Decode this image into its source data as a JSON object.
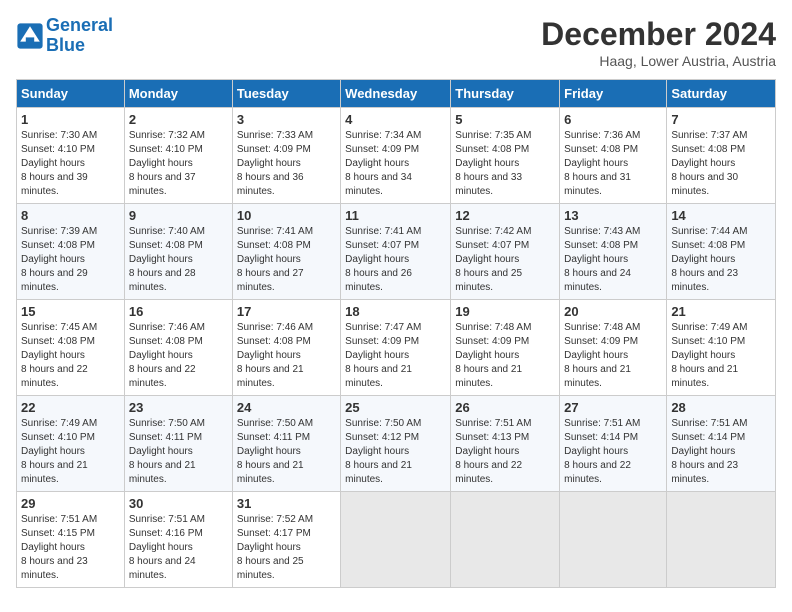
{
  "logo": {
    "line1": "General",
    "line2": "Blue"
  },
  "title": "December 2024",
  "location": "Haag, Lower Austria, Austria",
  "days_of_week": [
    "Sunday",
    "Monday",
    "Tuesday",
    "Wednesday",
    "Thursday",
    "Friday",
    "Saturday"
  ],
  "weeks": [
    [
      {
        "day": "1",
        "sunrise": "7:30 AM",
        "sunset": "4:10 PM",
        "daylight": "8 hours and 39 minutes."
      },
      {
        "day": "2",
        "sunrise": "7:32 AM",
        "sunset": "4:10 PM",
        "daylight": "8 hours and 37 minutes."
      },
      {
        "day": "3",
        "sunrise": "7:33 AM",
        "sunset": "4:09 PM",
        "daylight": "8 hours and 36 minutes."
      },
      {
        "day": "4",
        "sunrise": "7:34 AM",
        "sunset": "4:09 PM",
        "daylight": "8 hours and 34 minutes."
      },
      {
        "day": "5",
        "sunrise": "7:35 AM",
        "sunset": "4:08 PM",
        "daylight": "8 hours and 33 minutes."
      },
      {
        "day": "6",
        "sunrise": "7:36 AM",
        "sunset": "4:08 PM",
        "daylight": "8 hours and 31 minutes."
      },
      {
        "day": "7",
        "sunrise": "7:37 AM",
        "sunset": "4:08 PM",
        "daylight": "8 hours and 30 minutes."
      }
    ],
    [
      {
        "day": "8",
        "sunrise": "7:39 AM",
        "sunset": "4:08 PM",
        "daylight": "8 hours and 29 minutes."
      },
      {
        "day": "9",
        "sunrise": "7:40 AM",
        "sunset": "4:08 PM",
        "daylight": "8 hours and 28 minutes."
      },
      {
        "day": "10",
        "sunrise": "7:41 AM",
        "sunset": "4:08 PM",
        "daylight": "8 hours and 27 minutes."
      },
      {
        "day": "11",
        "sunrise": "7:41 AM",
        "sunset": "4:07 PM",
        "daylight": "8 hours and 26 minutes."
      },
      {
        "day": "12",
        "sunrise": "7:42 AM",
        "sunset": "4:07 PM",
        "daylight": "8 hours and 25 minutes."
      },
      {
        "day": "13",
        "sunrise": "7:43 AM",
        "sunset": "4:08 PM",
        "daylight": "8 hours and 24 minutes."
      },
      {
        "day": "14",
        "sunrise": "7:44 AM",
        "sunset": "4:08 PM",
        "daylight": "8 hours and 23 minutes."
      }
    ],
    [
      {
        "day": "15",
        "sunrise": "7:45 AM",
        "sunset": "4:08 PM",
        "daylight": "8 hours and 22 minutes."
      },
      {
        "day": "16",
        "sunrise": "7:46 AM",
        "sunset": "4:08 PM",
        "daylight": "8 hours and 22 minutes."
      },
      {
        "day": "17",
        "sunrise": "7:46 AM",
        "sunset": "4:08 PM",
        "daylight": "8 hours and 21 minutes."
      },
      {
        "day": "18",
        "sunrise": "7:47 AM",
        "sunset": "4:09 PM",
        "daylight": "8 hours and 21 minutes."
      },
      {
        "day": "19",
        "sunrise": "7:48 AM",
        "sunset": "4:09 PM",
        "daylight": "8 hours and 21 minutes."
      },
      {
        "day": "20",
        "sunrise": "7:48 AM",
        "sunset": "4:09 PM",
        "daylight": "8 hours and 21 minutes."
      },
      {
        "day": "21",
        "sunrise": "7:49 AM",
        "sunset": "4:10 PM",
        "daylight": "8 hours and 21 minutes."
      }
    ],
    [
      {
        "day": "22",
        "sunrise": "7:49 AM",
        "sunset": "4:10 PM",
        "daylight": "8 hours and 21 minutes."
      },
      {
        "day": "23",
        "sunrise": "7:50 AM",
        "sunset": "4:11 PM",
        "daylight": "8 hours and 21 minutes."
      },
      {
        "day": "24",
        "sunrise": "7:50 AM",
        "sunset": "4:11 PM",
        "daylight": "8 hours and 21 minutes."
      },
      {
        "day": "25",
        "sunrise": "7:50 AM",
        "sunset": "4:12 PM",
        "daylight": "8 hours and 21 minutes."
      },
      {
        "day": "26",
        "sunrise": "7:51 AM",
        "sunset": "4:13 PM",
        "daylight": "8 hours and 22 minutes."
      },
      {
        "day": "27",
        "sunrise": "7:51 AM",
        "sunset": "4:14 PM",
        "daylight": "8 hours and 22 minutes."
      },
      {
        "day": "28",
        "sunrise": "7:51 AM",
        "sunset": "4:14 PM",
        "daylight": "8 hours and 23 minutes."
      }
    ],
    [
      {
        "day": "29",
        "sunrise": "7:51 AM",
        "sunset": "4:15 PM",
        "daylight": "8 hours and 23 minutes."
      },
      {
        "day": "30",
        "sunrise": "7:51 AM",
        "sunset": "4:16 PM",
        "daylight": "8 hours and 24 minutes."
      },
      {
        "day": "31",
        "sunrise": "7:52 AM",
        "sunset": "4:17 PM",
        "daylight": "8 hours and 25 minutes."
      },
      null,
      null,
      null,
      null
    ]
  ],
  "labels": {
    "sunrise": "Sunrise:",
    "sunset": "Sunset:",
    "daylight": "Daylight hours"
  }
}
